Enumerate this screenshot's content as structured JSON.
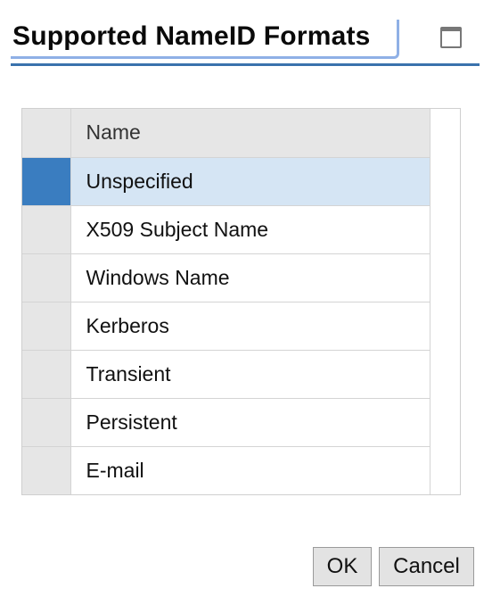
{
  "dialog": {
    "title": "Supported NameID Formats"
  },
  "table": {
    "header": "Name",
    "selected_index": 0,
    "rows": [
      "Unspecified",
      "X509 Subject Name",
      "Windows Name",
      "Kerberos",
      "Transient",
      "Persistent",
      "E-mail"
    ]
  },
  "buttons": {
    "ok_label": "OK",
    "cancel_label": "Cancel"
  },
  "colors": {
    "accent": "#3a72ad",
    "selected_marker": "#3a7dc0",
    "selected_row": "#d5e5f4",
    "header_bg": "#e6e6e6"
  }
}
